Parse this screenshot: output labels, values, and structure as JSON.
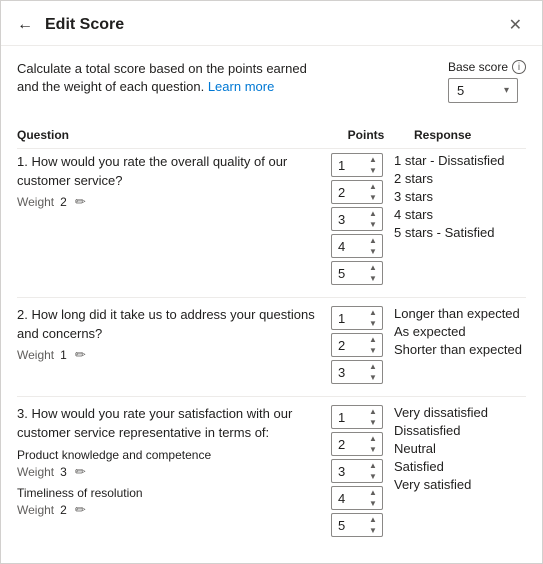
{
  "header": {
    "title": "Edit Score",
    "back_label": "←",
    "close_label": "✕"
  },
  "description": {
    "text": "Calculate a total score based on the points earned and the weight of each question.",
    "link_text": "Learn more"
  },
  "base_score": {
    "label": "Base score",
    "value": "5",
    "info": "ⓘ"
  },
  "table_headers": {
    "question": "Question",
    "points": "Points",
    "response": "Response"
  },
  "questions": [
    {
      "id": "q1",
      "text": "1. How would you rate the overall quality of our customer service?",
      "weight_label": "Weight",
      "weight_value": "2",
      "responses": [
        {
          "points": "1",
          "text": "1 star - Dissatisfied"
        },
        {
          "points": "2",
          "text": "2 stars"
        },
        {
          "points": "3",
          "text": "3 stars"
        },
        {
          "points": "4",
          "text": "4 stars"
        },
        {
          "points": "5",
          "text": "5 stars - Satisfied"
        }
      ]
    },
    {
      "id": "q2",
      "text": "2. How long did it take us to address your questions and concerns?",
      "weight_label": "Weight",
      "weight_value": "1",
      "responses": [
        {
          "points": "1",
          "text": "Longer than expected"
        },
        {
          "points": "2",
          "text": "As expected"
        },
        {
          "points": "3",
          "text": "Shorter than expected"
        }
      ]
    },
    {
      "id": "q3",
      "text": "3. How would you rate your satisfaction with our customer service representative in terms of:",
      "sub_items": [
        {
          "label": "Product knowledge and competence",
          "weight_label": "Weight",
          "weight_value": "3"
        },
        {
          "label": "Timeliness of resolution",
          "weight_label": "Weight",
          "weight_value": "2"
        }
      ],
      "responses": [
        {
          "points": "1",
          "text": "Very dissatisfied"
        },
        {
          "points": "2",
          "text": "Dissatisfied"
        },
        {
          "points": "3",
          "text": "Neutral"
        },
        {
          "points": "4",
          "text": "Satisfied"
        },
        {
          "points": "5",
          "text": "Very satisfied"
        }
      ]
    }
  ]
}
